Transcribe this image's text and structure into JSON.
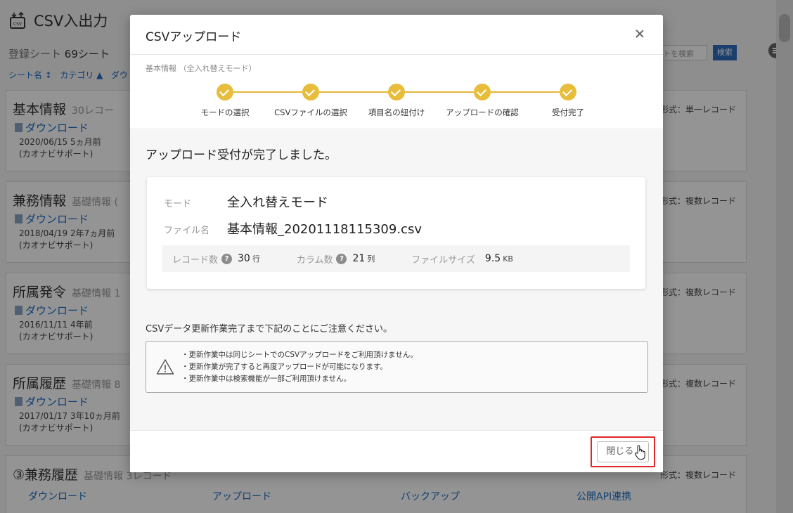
{
  "background": {
    "title": "CSV入出力",
    "sheet_count_label": "登録シート",
    "sheet_count_value": "69シート",
    "sort_items": [
      "シート名 ↕",
      "カテゴリ ▲",
      "ダウ"
    ],
    "search_placeholder": "トを検索",
    "search_button": "検索",
    "cards": [
      {
        "name": "基本情報",
        "sub": "30レコー",
        "dl": "ダウンロード",
        "date": "2020/06/15 5ヵ月前",
        "org": "(カオナビサポート)",
        "fmt": "形式：単一レコード"
      },
      {
        "name": "兼務情報",
        "sub": "基礎情報 (",
        "dl": "ダウンロード",
        "date": "2018/04/19 2年7ヵ月前",
        "org": "(カオナビサポート)",
        "fmt": "形式：複数レコード"
      },
      {
        "name": "所属発令",
        "sub": "基礎情報 1",
        "dl": "ダウンロード",
        "date": "2016/11/11 4年前",
        "org": "(カオナビサポート)",
        "fmt": "形式：複数レコード"
      },
      {
        "name": "所属履歴",
        "sub": "基礎情報 8",
        "dl": "ダウンロード",
        "date": "2017/01/17 3年10ヵ月前",
        "org": "(カオナビサポート)",
        "fmt": "形式：複数レコード"
      },
      {
        "name": "③兼務履歴",
        "sub": "基礎情報 3レコード",
        "fmt": "形式：複数レコード"
      }
    ],
    "bottom_links": [
      "ダウンロード",
      "アップロード",
      "バックアップ",
      "公開API連携"
    ]
  },
  "modal": {
    "title": "CSVアップロード",
    "step_caption": "基本情報 （全入れ替えモード）",
    "steps": [
      "モードの選択",
      "CSVファイルの選択",
      "項目名の紐付け",
      "アップロードの確認",
      "受付完了"
    ],
    "done_message": "アップロード受付が完了しました。",
    "mode_label": "モード",
    "mode_value": "全入れ替えモード",
    "file_label": "ファイル名",
    "file_value": "基本情報_20201118115309.csv",
    "records_label": "レコード数",
    "records_value": "30",
    "records_unit": "行",
    "columns_label": "カラム数",
    "columns_value": "21",
    "columns_unit": "列",
    "filesize_label": "ファイルサイズ",
    "filesize_value": "9.5",
    "filesize_unit": "KB",
    "notice_title": "CSVデータ更新作業完了まで下記のことにご注意ください。",
    "notices": [
      "・更新作業中は同じシートでのCSVアップロードをご利用頂けません。",
      "・更新作業が完了すると再度アップロードが可能になります。",
      "・更新作業中は検索機能が一部ご利用頂けません。"
    ],
    "close_button": "閉じる"
  },
  "colors": {
    "step_done": "#e8bd3c",
    "highlight": "#e0262a",
    "link": "#1a6bc4"
  }
}
